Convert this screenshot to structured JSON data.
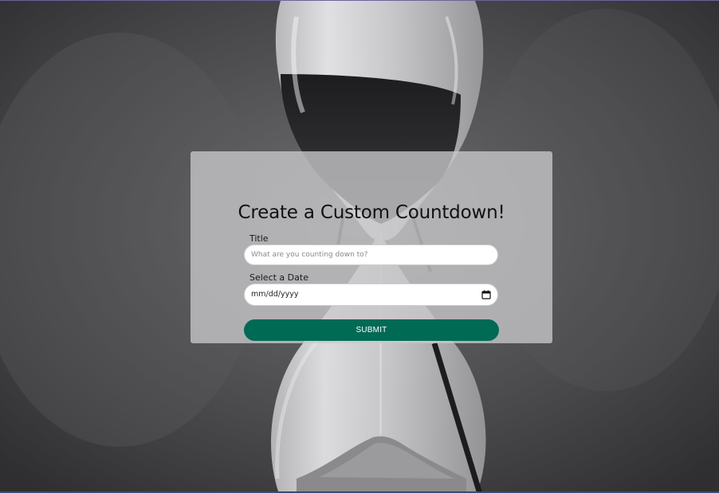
{
  "form": {
    "heading": "Create a Custom Countdown!",
    "title_label": "Title",
    "title_placeholder": "What are you counting down to?",
    "date_label": "Select a Date",
    "date_placeholder": "mm/dd/yyyy",
    "submit_label": "SUBMIT"
  },
  "colors": {
    "submit_background": "#006a55",
    "card_background": "rgba(200,200,202,0.78)"
  },
  "icons": {
    "date_picker": "calendar-icon"
  }
}
